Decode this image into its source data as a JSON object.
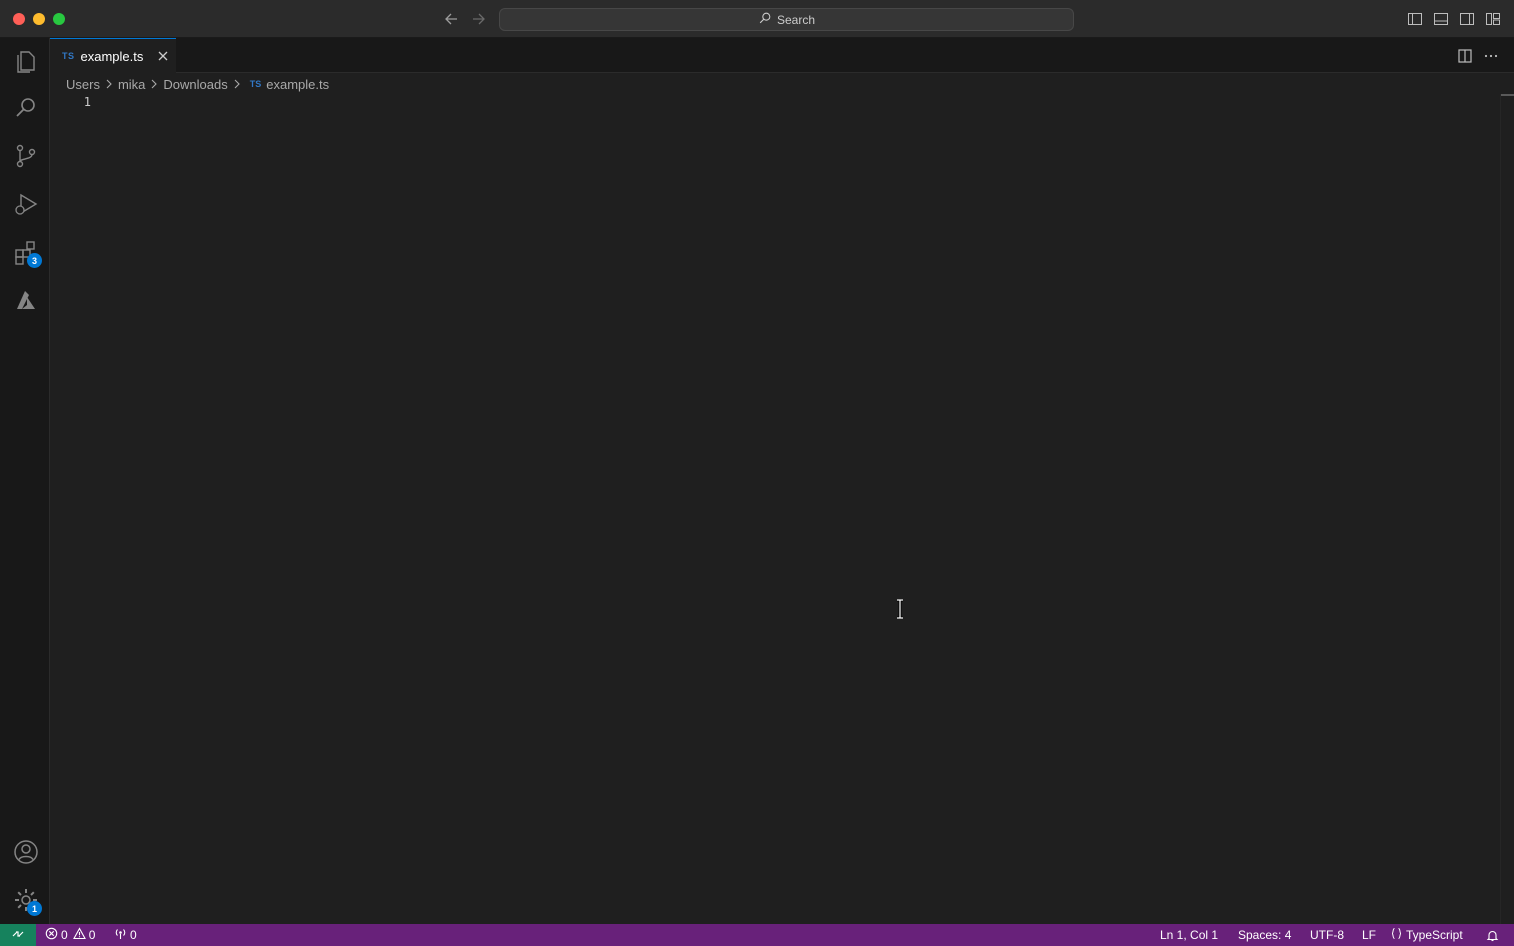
{
  "titlebar": {
    "search_label": "Search"
  },
  "activitybar": {
    "items": [
      {
        "name": "explorer",
        "icon": "files-icon"
      },
      {
        "name": "search",
        "icon": "search-icon"
      },
      {
        "name": "source-control",
        "icon": "source-control-icon"
      },
      {
        "name": "run-debug",
        "icon": "run-debug-icon"
      },
      {
        "name": "extensions",
        "icon": "extensions-icon",
        "badge": "3"
      },
      {
        "name": "azure",
        "icon": "azure-icon"
      }
    ],
    "bottom": [
      {
        "name": "accounts",
        "icon": "account-icon"
      },
      {
        "name": "manage",
        "icon": "gear-icon",
        "badge": "1"
      }
    ]
  },
  "tabs": [
    {
      "lang_badge": "TS",
      "label": "example.ts",
      "active": true
    }
  ],
  "breadcrumb": {
    "segments": [
      "Users",
      "mika",
      "Downloads"
    ],
    "file_badge": "TS",
    "file": "example.ts"
  },
  "editor": {
    "line_numbers": [
      "1"
    ],
    "content": ""
  },
  "statusbar": {
    "errors": "0",
    "warnings": "0",
    "ports": "0",
    "position": "Ln 1, Col 1",
    "indentation": "Spaces: 4",
    "encoding": "UTF-8",
    "eol": "LF",
    "language": "TypeScript",
    "colors": {
      "background": "#68217a",
      "remote": "#16825d"
    }
  }
}
